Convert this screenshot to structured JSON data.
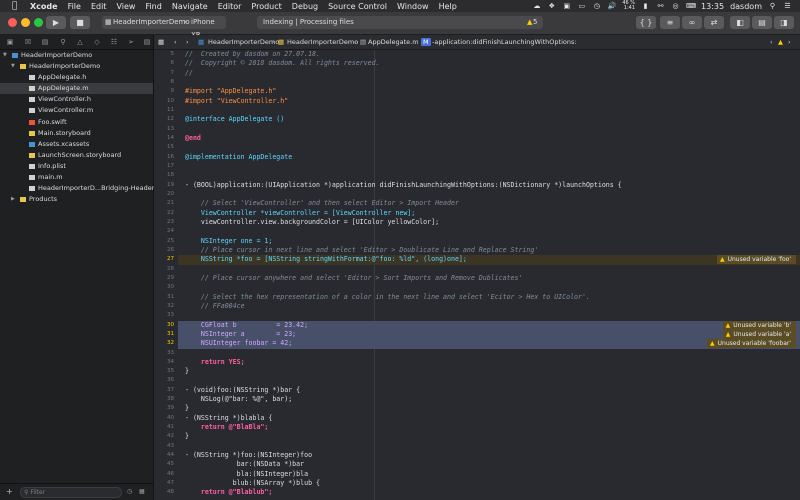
{
  "menubar": {
    "app_name": "Xcode",
    "items": [
      "File",
      "Edit",
      "View",
      "Find",
      "Navigate",
      "Editor",
      "Product",
      "Debug",
      "Source Control",
      "Window",
      "Help"
    ],
    "battery_percent": "46 %",
    "battery_time": "1:41",
    "clock": "13:35",
    "user": "dasdom"
  },
  "toolbar": {
    "scheme_name": "HeaderImporterDemo",
    "destination": "iPhone XR",
    "status_text": "Indexing | Processing files",
    "warning_count": "5"
  },
  "navigator": {
    "filter_placeholder": "Filter",
    "items": [
      {
        "label": "HeaderImporterDemo"
      },
      {
        "label": "HeaderImporterDemo"
      },
      {
        "label": "AppDelegate.h"
      },
      {
        "label": "AppDelegate.m"
      },
      {
        "label": "ViewController.h"
      },
      {
        "label": "ViewController.m"
      },
      {
        "label": "Foo.swift"
      },
      {
        "label": "Main.storyboard"
      },
      {
        "label": "Assets.xcassets"
      },
      {
        "label": "LaunchScreen.storyboard"
      },
      {
        "label": "Info.plist"
      },
      {
        "label": "main.m"
      },
      {
        "label": "HeaderImporterD...Bridging-Header.h"
      },
      {
        "label": "Products"
      }
    ]
  },
  "jumpbar": {
    "crumbs": [
      "HeaderImporterDemo",
      "HeaderImporterDemo",
      "AppDelegate.m",
      "-application:didFinishLaunchingWithOptions:"
    ]
  },
  "editor": {
    "lines": [
      {
        "n": "5",
        "code": "//  Created by dasdom on 27.07.18."
      },
      {
        "n": "6",
        "code": "//  Copyright © 2018 dasdom. All rights reserved."
      },
      {
        "n": "7",
        "code": "//"
      },
      {
        "n": "8",
        "code": ""
      },
      {
        "n": "9",
        "code": "#import \"AppDelegate.h\""
      },
      {
        "n": "10",
        "code": "#import \"ViewController.h\""
      },
      {
        "n": "11",
        "code": ""
      },
      {
        "n": "12",
        "code": "@interface AppDelegate ()"
      },
      {
        "n": "13",
        "code": ""
      },
      {
        "n": "14",
        "code": "@end"
      },
      {
        "n": "15",
        "code": ""
      },
      {
        "n": "16",
        "code": "@implementation AppDelegate"
      },
      {
        "n": "17",
        "code": ""
      },
      {
        "n": "18",
        "code": ""
      },
      {
        "n": "19",
        "code": "- (BOOL)application:(UIApplication *)application didFinishLaunchingWithOptions:(NSDictionary *)launchOptions {"
      },
      {
        "n": "20",
        "code": ""
      },
      {
        "n": "21",
        "code": "    // Select 'ViewController' and then select Editor > Import Header"
      },
      {
        "n": "22",
        "code": "    ViewController *viewController = [ViewController new];"
      },
      {
        "n": "23",
        "code": "    viewController.view.backgroundColor = [UIColor yellowColor];"
      },
      {
        "n": "24",
        "code": ""
      },
      {
        "n": "25",
        "code": "    NSInteger one = 1;"
      },
      {
        "n": "26",
        "code": "    // Place cursor in next line and select 'Editor > Doublicate Line and Replace String'"
      },
      {
        "n": "27",
        "code": "    NSString *foo = [NSString stringWithFormat:@\"foo: %ld\", (long)one];"
      },
      {
        "n": "28",
        "code": ""
      },
      {
        "n": "29",
        "code": "    // Place cursor anywhere and select 'Editor > Sort Imports and Remove Dublicates'"
      },
      {
        "n": "30",
        "code": ""
      },
      {
        "n": "31",
        "code": "    // Select the hex representation of a color in the next line and select 'Ecitor > Hex to UIColor'."
      },
      {
        "n": "32",
        "code": "    // FFa004ce"
      },
      {
        "n": "33",
        "code": ""
      },
      {
        "n": "30",
        "code": "    CGFloat b          = 23.42;"
      },
      {
        "n": "31",
        "code": "    NSInteger a        = 23;"
      },
      {
        "n": "32",
        "code": "    NSUInteger foobar = 42;"
      },
      {
        "n": "33",
        "code": ""
      },
      {
        "n": "34",
        "code": "    return YES;"
      },
      {
        "n": "35",
        "code": "}"
      },
      {
        "n": "36",
        "code": ""
      },
      {
        "n": "37",
        "code": "- (void)foo:(NSString *)bar {"
      },
      {
        "n": "38",
        "code": "    NSLog(@\"bar: %@\", bar);"
      },
      {
        "n": "39",
        "code": "}"
      },
      {
        "n": "40",
        "code": "- (NSString *)blabla {"
      },
      {
        "n": "41",
        "code": "    return @\"BlaBla\";"
      },
      {
        "n": "42",
        "code": "}"
      },
      {
        "n": "43",
        "code": ""
      },
      {
        "n": "44",
        "code": "- (NSString *)foo:(NSInteger)foo"
      },
      {
        "n": "45",
        "code": "             bar:(NSData *)bar"
      },
      {
        "n": "46",
        "code": "             bla:(NSInteger)bla"
      },
      {
        "n": "47",
        "code": "            blub:(NSArray *)blub {"
      },
      {
        "n": "48",
        "code": "    return @\"Blablub\";"
      }
    ],
    "warnings": [
      {
        "text": "Unused variable 'foo'"
      },
      {
        "text": "Unused variable 'b'"
      },
      {
        "text": "Unused variable 'a'"
      },
      {
        "text": "Unused variable 'foobar'"
      }
    ]
  },
  "colors": {
    "editor_bg": "#292a30",
    "selection": "#484f69",
    "warning_line": "#3c3523",
    "warning_yellow": "#ffcc00"
  }
}
